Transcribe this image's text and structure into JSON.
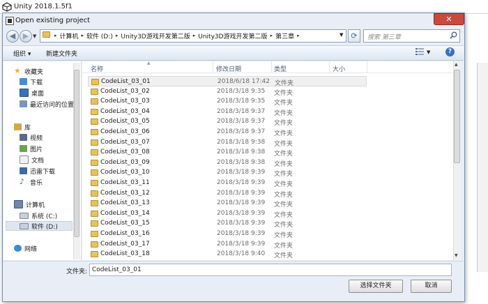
{
  "window": {
    "title": "Unity 2018.1.5f1"
  },
  "dialog": {
    "title": "Open existing project",
    "close_symbol": "✕"
  },
  "address": {
    "crumbs": [
      "计算机",
      "软件 (D:)",
      "Unity3D游戏开发第二版",
      "Unity3D游戏开发第二版",
      "第三章"
    ],
    "separator": "▸",
    "search_placeholder": "搜索 第三章"
  },
  "toolbar": {
    "organize": "组织 ▾",
    "new_folder": "新建文件夹",
    "help": "?"
  },
  "nav": {
    "favorites": {
      "label": "收藏夹",
      "items": [
        "下载",
        "桌面",
        "最近访问的位置"
      ]
    },
    "libraries": {
      "label": "库",
      "items": [
        "视频",
        "图片",
        "文档",
        "迅雷下载",
        "音乐"
      ]
    },
    "computer": {
      "label": "计算机",
      "items": [
        "系统 (C:)",
        "软件 (D:)"
      ],
      "selected": "软件 (D:)"
    },
    "network": {
      "label": "网络"
    }
  },
  "columns": {
    "name": "名称",
    "date": "修改日期",
    "type": "类型",
    "size": "大小"
  },
  "files": [
    {
      "name": "CodeList_03_01",
      "date": "2018/6/18 17:42",
      "type": "文件夹"
    },
    {
      "name": "CodeList_03_02",
      "date": "2018/3/18 9:35",
      "type": "文件夹"
    },
    {
      "name": "CodeList_03_03",
      "date": "2018/3/18 9:35",
      "type": "文件夹"
    },
    {
      "name": "CodeList_03_04",
      "date": "2018/3/18 9:37",
      "type": "文件夹"
    },
    {
      "name": "CodeList_03_05",
      "date": "2018/3/18 9:37",
      "type": "文件夹"
    },
    {
      "name": "CodeList_03_06",
      "date": "2018/3/18 9:37",
      "type": "文件夹"
    },
    {
      "name": "CodeList_03_07",
      "date": "2018/3/18 9:38",
      "type": "文件夹"
    },
    {
      "name": "CodeList_03_08",
      "date": "2018/3/18 9:38",
      "type": "文件夹"
    },
    {
      "name": "CodeList_03_09",
      "date": "2018/3/18 9:38",
      "type": "文件夹"
    },
    {
      "name": "CodeList_03_10",
      "date": "2018/3/18 9:39",
      "type": "文件夹"
    },
    {
      "name": "CodeList_03_11",
      "date": "2018/3/18 9:39",
      "type": "文件夹"
    },
    {
      "name": "CodeList_03_12",
      "date": "2018/3/18 9:39",
      "type": "文件夹"
    },
    {
      "name": "CodeList_03_13",
      "date": "2018/3/18 9:39",
      "type": "文件夹"
    },
    {
      "name": "CodeList_03_14",
      "date": "2018/3/18 9:39",
      "type": "文件夹"
    },
    {
      "name": "CodeList_03_15",
      "date": "2018/3/18 9:39",
      "type": "文件夹"
    },
    {
      "name": "CodeList_03_16",
      "date": "2018/3/18 9:39",
      "type": "文件夹"
    },
    {
      "name": "CodeList_03_17",
      "date": "2018/3/18 9:39",
      "type": "文件夹"
    },
    {
      "name": "CodeList_03_18",
      "date": "2018/3/18 9:40",
      "type": "文件夹"
    }
  ],
  "selected_file": "CodeList_03_01",
  "footer": {
    "filename_label": "文件夹:",
    "filename_value": "CodeList_03_01",
    "select_button": "选择文件夹",
    "cancel_button": "取消"
  },
  "colors": {
    "accent": "#3a6fc4",
    "folder": "#e8c25b",
    "close": "#c94a3c"
  }
}
